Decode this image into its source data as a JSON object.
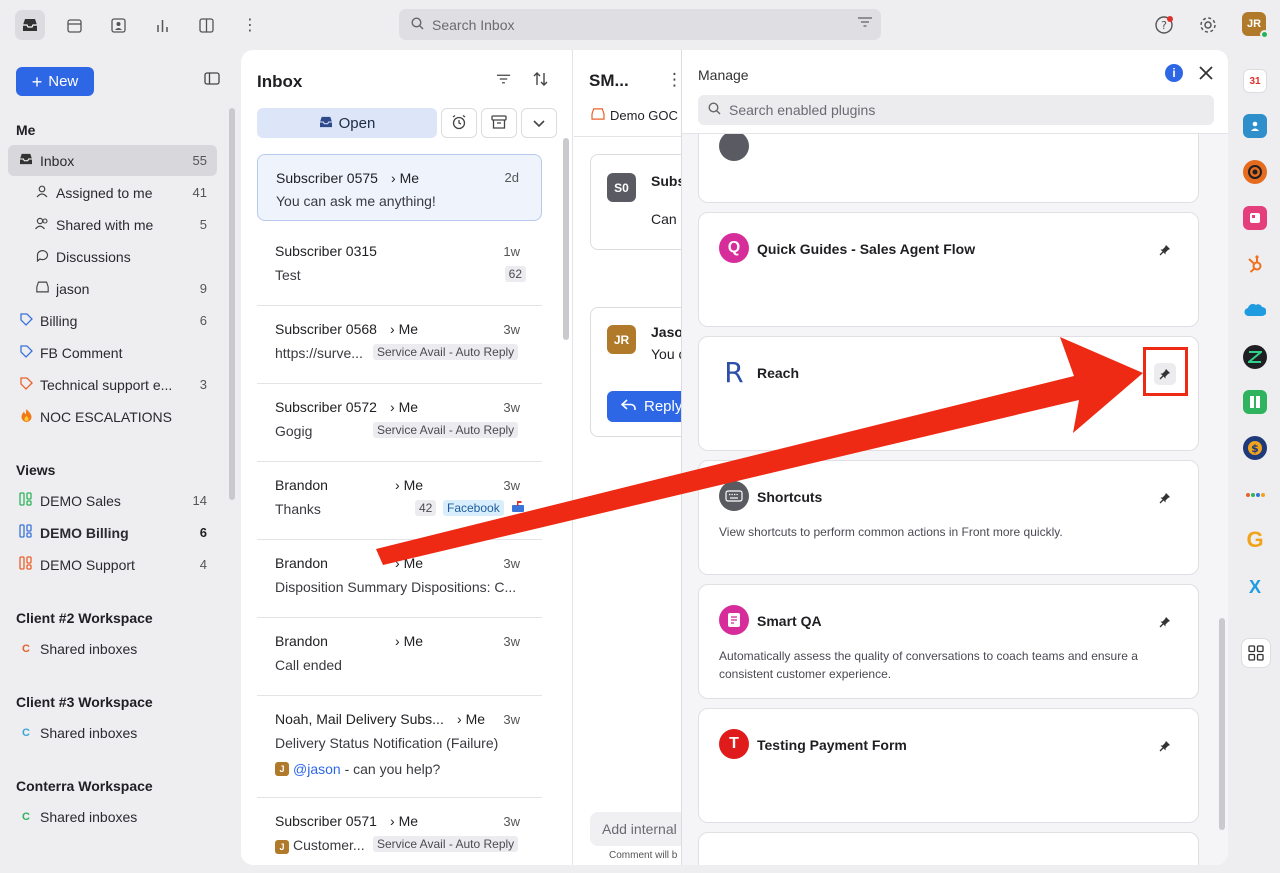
{
  "topbar": {
    "search_placeholder": "Search Inbox",
    "user_initials": "JR"
  },
  "sidebar": {
    "new_label": "New",
    "me_heading": "Me",
    "me_items": [
      {
        "label": "Inbox",
        "count": "55",
        "icon": "inbox-icon"
      },
      {
        "label": "Assigned to me",
        "count": "41",
        "icon": "user-assigned-icon"
      },
      {
        "label": "Shared with me",
        "count": "5",
        "icon": "users-icon"
      },
      {
        "label": "Discussions",
        "count": "",
        "icon": "chat-icon"
      },
      {
        "label": "jason",
        "count": "9",
        "icon": "inbox-icon"
      },
      {
        "label": "Billing",
        "count": "6",
        "icon": "tag-icon"
      },
      {
        "label": "FB Comment",
        "count": "",
        "icon": "tag-icon"
      },
      {
        "label": "Technical support e...",
        "count": "3",
        "icon": "tag-icon"
      },
      {
        "label": "NOC ESCALATIONS",
        "count": "",
        "icon": "fire-icon"
      }
    ],
    "views_heading": "Views",
    "views": [
      {
        "label": "DEMO Sales",
        "count": "14"
      },
      {
        "label": "DEMO Billing",
        "count": "6"
      },
      {
        "label": "DEMO Support",
        "count": "4"
      }
    ],
    "workspaces": [
      {
        "heading": "Client #2 Workspace",
        "item": "Shared inboxes",
        "letter": "C",
        "color": "#e8622c"
      },
      {
        "heading": "Client #3 Workspace",
        "item": "Shared inboxes",
        "letter": "C",
        "color": "#3aa6d8"
      },
      {
        "heading": "Conterra Workspace",
        "item": "Shared inboxes",
        "letter": "C",
        "color": "#2fb35e"
      }
    ]
  },
  "inbox": {
    "title": "Inbox",
    "open_label": "Open",
    "conversations": [
      {
        "who": "Subscriber 0575",
        "me": "Me",
        "time": "2d",
        "snippet": "You can ask me anything!"
      },
      {
        "who": "Subscriber 0315",
        "me": "",
        "time": "1w",
        "snippet": "Test",
        "count": "62"
      },
      {
        "who": "Subscriber 0568",
        "me": "Me",
        "time": "3w",
        "snippet": "https://surve...",
        "tag": "Service Avail - Auto Reply"
      },
      {
        "who": "Subscriber 0572",
        "me": "Me",
        "time": "3w",
        "snippet": "Gogig",
        "tag": "Service Avail - Auto Reply"
      },
      {
        "who": "Brandon",
        "me": "Me",
        "time": "3w",
        "snippet": "Thanks",
        "count": "42",
        "tag": "Facebook"
      },
      {
        "who": "Brandon",
        "me": "Me",
        "time": "3w",
        "snippet": "Disposition Summary Dispositions: C..."
      },
      {
        "who": "Brandon",
        "me": "Me",
        "time": "3w",
        "snippet": "Call ended"
      },
      {
        "who": "Noah, Mail Delivery Subs...",
        "me": "Me",
        "time": "3w",
        "snippet": "Delivery Status Notification (Failure)",
        "mention": "@jason",
        "mention_rest": " - can you help?"
      },
      {
        "who": "Subscriber 0571",
        "me": "Me",
        "time": "3w",
        "snippet": "Customer...",
        "tag": "Service Avail - Auto Reply"
      }
    ]
  },
  "conversation": {
    "title": "SM...",
    "inbox_label": "Demo GOC",
    "msg1_initials": "S0",
    "msg1_name": "Subs",
    "msg1_text": "Can",
    "msg2_initials": "JR",
    "msg2_name": "Jaso",
    "msg2_text": "You c",
    "reply_label": "Reply",
    "comment_placeholder": "Add internal",
    "comment_hint": "Comment will b"
  },
  "manage": {
    "title": "Manage",
    "search_placeholder": "Search enabled plugins",
    "plugins": [
      {
        "name": "Quick Guides - Sales Agent Flow",
        "desc": "",
        "letter": "Q",
        "color": "#d62d9b"
      },
      {
        "name": "Reach",
        "desc": "",
        "letter": "R",
        "color": "#ffffff"
      },
      {
        "name": "Shortcuts",
        "desc": "View shortcuts to perform common actions in Front more quickly.",
        "letter": "⌨",
        "color": "#5a5a62"
      },
      {
        "name": "Smart QA",
        "desc": "Automatically assess the quality of conversations to coach teams and ensure a consistent customer experience.",
        "letter": "▤",
        "color": "#d62d9b"
      },
      {
        "name": "Testing Payment Form",
        "desc": "",
        "letter": "T",
        "color": "#e01b1b"
      }
    ]
  },
  "rail": {
    "calendar_day": "31"
  },
  "colors": {
    "accent": "#2d67e6",
    "annotation": "#ee2a14"
  }
}
